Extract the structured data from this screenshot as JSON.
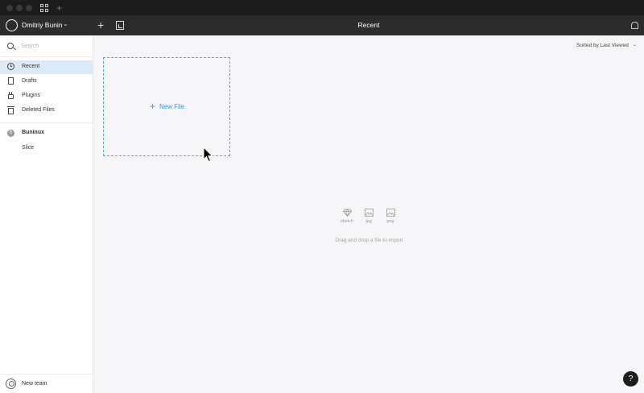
{
  "window": {
    "tab_plus": "+"
  },
  "toolbar": {
    "user_name": "Dmitriy Bunin",
    "add_label": "+",
    "title": "Recent"
  },
  "sidebar": {
    "search_placeholder": "Search",
    "items": [
      {
        "label": "Recent",
        "icon": "clock-icon"
      },
      {
        "label": "Drafts",
        "icon": "document-icon"
      },
      {
        "label": "Plugins",
        "icon": "plug-icon"
      },
      {
        "label": "Deleted Files",
        "icon": "trash-icon"
      }
    ],
    "team": {
      "name": "Buninux",
      "project": "Slice"
    },
    "new_team": "New team"
  },
  "main": {
    "sort_label": "Sorted by Last Viewed",
    "new_file": "New File",
    "file_types": [
      {
        "label": "sketch",
        "icon": "diamond-icon"
      },
      {
        "label": "jpg",
        "icon": "image-icon"
      },
      {
        "label": "png",
        "icon": "image-icon"
      }
    ],
    "drop_hint": "Drag and drop a file to import"
  },
  "help": "?",
  "colors": {
    "accent": "#2b99e7",
    "active_bg": "#daebf7",
    "toolbar_bg": "#2c2c2c"
  }
}
